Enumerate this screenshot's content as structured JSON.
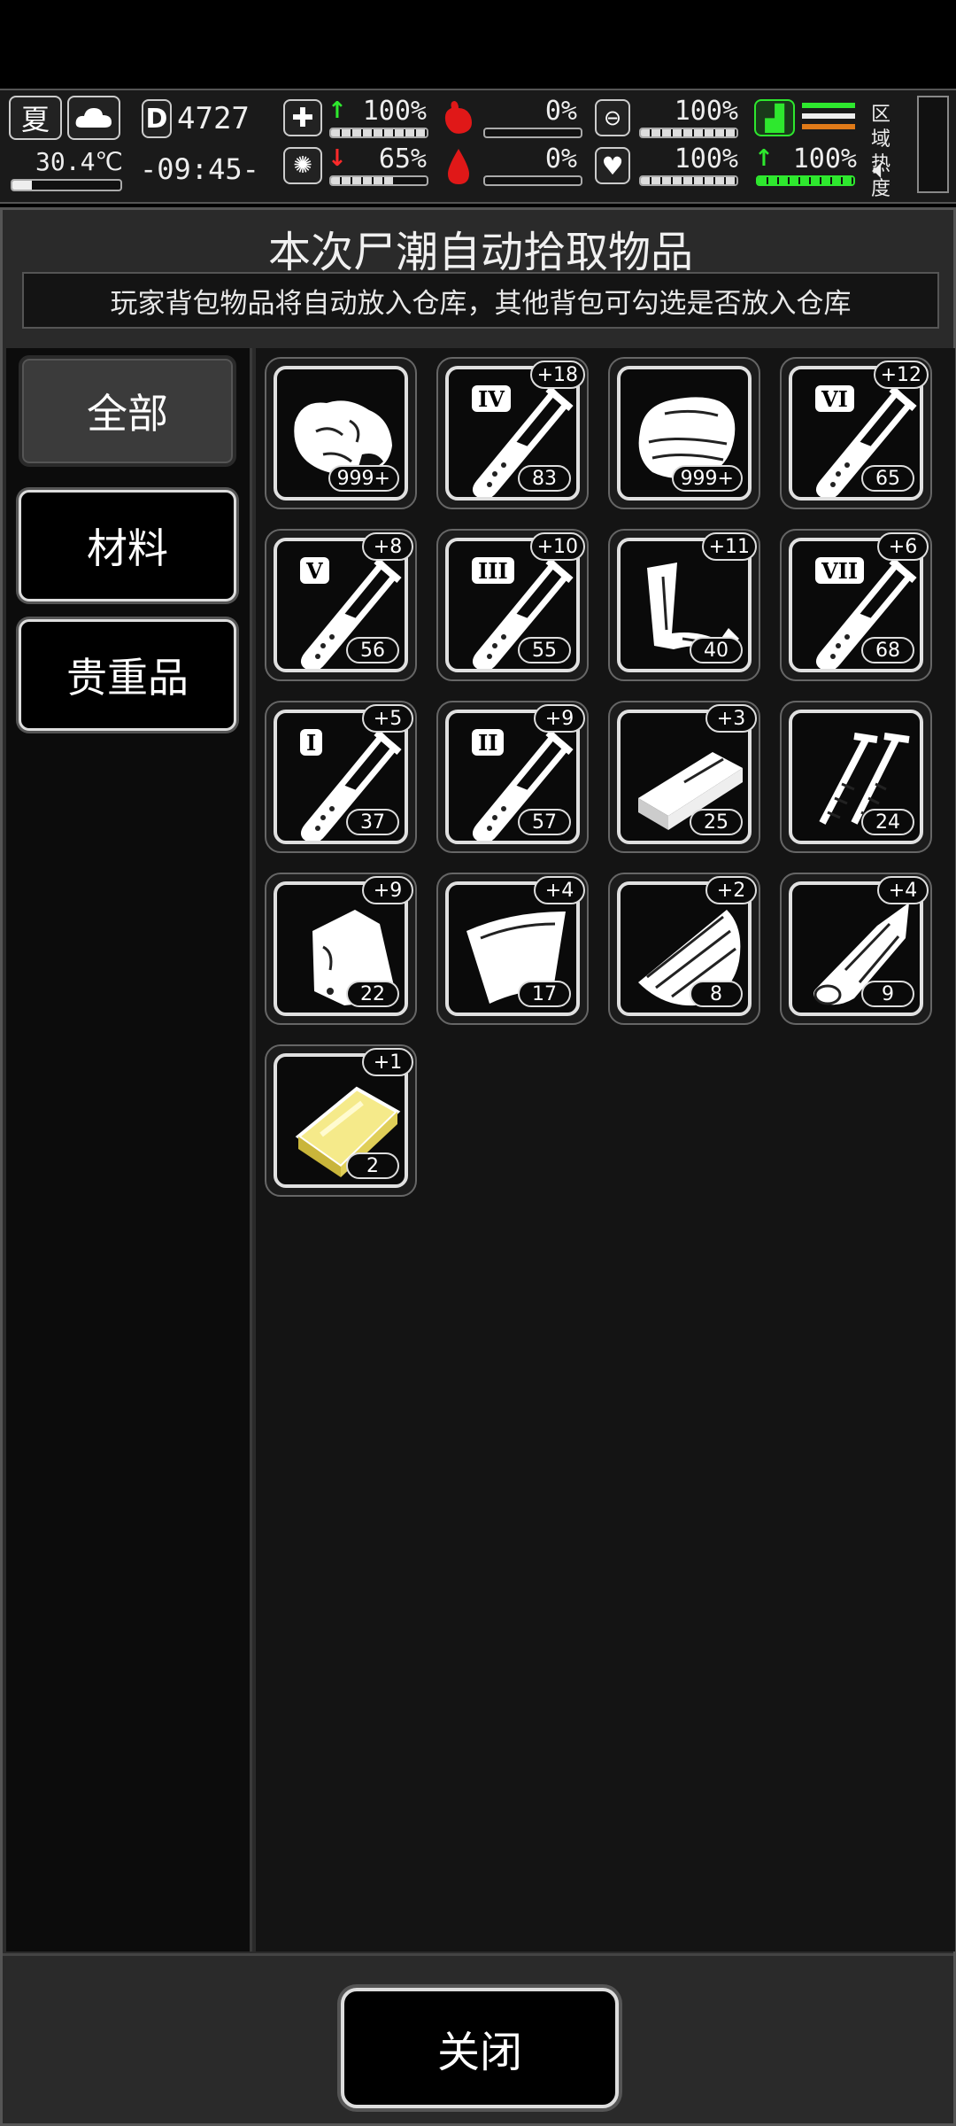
{
  "hud": {
    "season": "夏",
    "temperature": "30.4℃",
    "day": "4727",
    "time": "-09:45-",
    "health_pct": "100%",
    "brain_pct": "65%",
    "hunger_pct": "0%",
    "thirst_pct": "0%",
    "stamina_pct": "100%",
    "heart_pct": "100%",
    "speed_pct": "100%",
    "region_heat_label": "区域热度"
  },
  "panel": {
    "title": "本次尸潮自动拾取物品",
    "subtitle": "玩家背包物品将自动放入仓库，其他背包可勾选是否放入仓库"
  },
  "tabs": [
    {
      "label": "全部"
    },
    {
      "label": "材料"
    },
    {
      "label": "贵重品"
    }
  ],
  "items": [
    {
      "name": "rock",
      "count": "999+",
      "plus": ""
    },
    {
      "name": "vial-iv",
      "count": "83",
      "plus": "+18",
      "roman": "IV"
    },
    {
      "name": "cloth",
      "count": "999+",
      "plus": ""
    },
    {
      "name": "vial-vi",
      "count": "65",
      "plus": "+12",
      "roman": "VI"
    },
    {
      "name": "vial-v",
      "count": "56",
      "plus": "+8",
      "roman": "V"
    },
    {
      "name": "vial-iii",
      "count": "55",
      "plus": "+10",
      "roman": "III"
    },
    {
      "name": "scrap-metal",
      "count": "40",
      "plus": "+11"
    },
    {
      "name": "vial-vii",
      "count": "68",
      "plus": "+6",
      "roman": "VII"
    },
    {
      "name": "vial-i",
      "count": "37",
      "plus": "+5",
      "roman": "I"
    },
    {
      "name": "vial-ii",
      "count": "57",
      "plus": "+9",
      "roman": "II"
    },
    {
      "name": "whetstone",
      "count": "25",
      "plus": "+3"
    },
    {
      "name": "screws",
      "count": "24",
      "plus": ""
    },
    {
      "name": "bag",
      "count": "22",
      "plus": "+9"
    },
    {
      "name": "plastic-sheet",
      "count": "17",
      "plus": "+4"
    },
    {
      "name": "wood-planks",
      "count": "8",
      "plus": "+2"
    },
    {
      "name": "log",
      "count": "9",
      "plus": "+4"
    },
    {
      "name": "gold-bar",
      "count": "2",
      "plus": "+1"
    }
  ],
  "footer": {
    "close_label": "关闭"
  }
}
